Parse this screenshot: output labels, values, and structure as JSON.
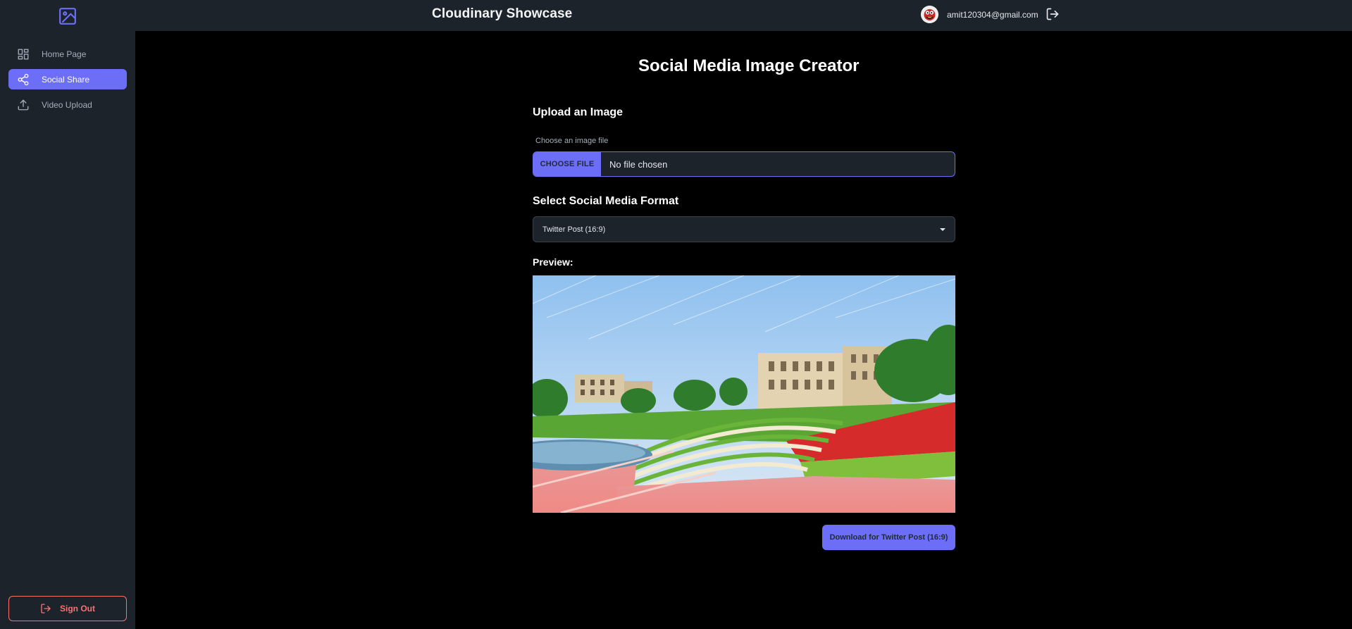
{
  "app": {
    "title": "Cloudinary Showcase",
    "brand_color": "#6d6ef7",
    "logo_icon": "image-icon"
  },
  "user": {
    "email": "amit120304@gmail.com",
    "avatar_icon": "avatar-icon",
    "logout_icon": "logout-icon"
  },
  "sidebar": {
    "items": [
      {
        "label": "Home Page",
        "icon": "grid-icon",
        "active": false
      },
      {
        "label": "Social Share",
        "icon": "share-icon",
        "active": true
      },
      {
        "label": "Video Upload",
        "icon": "upload-icon",
        "active": false
      }
    ],
    "sign_out_label": "Sign Out",
    "danger_color": "#f87272"
  },
  "main": {
    "title": "Social Media Image Creator",
    "upload_heading": "Upload an Image",
    "file_caption": "Choose an image file",
    "choose_file_label": "CHOOSE FILE",
    "file_status": "No file chosen",
    "format_heading": "Select Social Media Format",
    "format_selected": "Twitter Post (16:9)",
    "preview_label": "Preview:",
    "download_label": "Download for Twitter Post (16:9)"
  }
}
